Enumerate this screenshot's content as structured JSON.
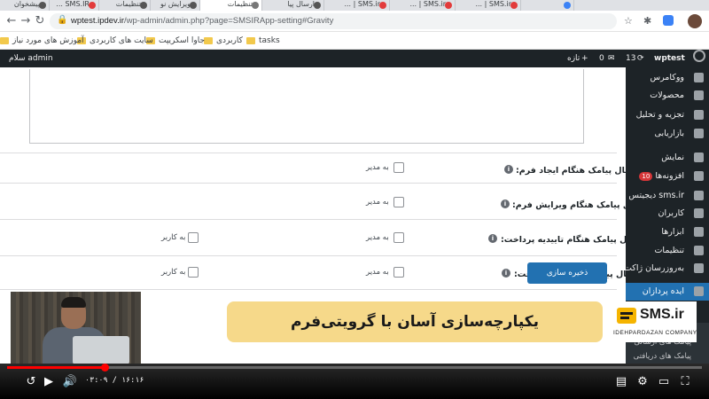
{
  "browser": {
    "tabs": [
      {
        "label": "پیشخوان",
        "icon": "wordpress-icon"
      },
      {
        "label": "SMS.IR ...",
        "icon": "sms-icon"
      },
      {
        "label": "تنظیمات",
        "icon": "wordpress-icon"
      },
      {
        "label": "ویرایش نو",
        "icon": "wordpress-icon"
      },
      {
        "label": "تنظیمات",
        "icon": "wordpress-icon",
        "active": true
      },
      {
        "label": "ارسال پیا",
        "icon": "wordpress-icon"
      },
      {
        "label": "SMS.ir | ...",
        "icon": "sms-icon"
      },
      {
        "label": "SMS.ir | ...",
        "icon": "sms-icon"
      },
      {
        "label": "SMS.ir | ...",
        "icon": "sms-icon"
      },
      {
        "label": "",
        "icon": "google-icon"
      }
    ],
    "url_domain": "wptest.ipdev.ir",
    "url_path": "/wp-admin/admin.php?page=SMSIRApp-setting#Gravity",
    "bookmarks": [
      "tasks",
      "کاربردی",
      "جاوا اسکریپت",
      "سایت های کاربردی",
      "آموزش های مورد نیاز"
    ]
  },
  "adminbar": {
    "site_name": "wptest",
    "updates_count": "13",
    "comments_count": "0",
    "new_label": "تازه",
    "greeting": "سلام admin"
  },
  "sidebar": {
    "items": [
      {
        "label": "ووکامرس",
        "icon": "woocommerce-icon"
      },
      {
        "label": "محصولات",
        "icon": "products-icon"
      },
      {
        "label": "تجزیه و تحلیل",
        "icon": "analytics-icon"
      },
      {
        "label": "بازاریابی",
        "icon": "marketing-icon"
      },
      {
        "label": "نمایش",
        "icon": "appearance-icon"
      },
      {
        "label": "افزونه‌ها",
        "icon": "plugins-icon",
        "badge": "10"
      },
      {
        "label": "sms.ir دیجیتس",
        "icon": "digits-icon"
      },
      {
        "label": "کاربران",
        "icon": "users-icon"
      },
      {
        "label": "ابزارها",
        "icon": "tools-icon"
      },
      {
        "label": "تنظیمات",
        "icon": "settings-icon"
      },
      {
        "label": "به‌روزرسان ژاکت",
        "icon": "update-icon"
      },
      {
        "label": "ایده پردازان",
        "icon": "smsir-icon",
        "active": true
      }
    ],
    "subitems": [
      "ارسال پیامک",
      "پیامک های ارسالی",
      "پیامک های دریافتی"
    ]
  },
  "form": {
    "rows": [
      {
        "label": "ارسال پیامک هنگام ایجاد فرم:",
        "admin": "به مدیر"
      },
      {
        "label": "ارسال پیامک هنگام ویرایش فرم:",
        "admin": "به مدیر"
      },
      {
        "label": "ارسال پیامک هنگام تاییدیه پرداخت:",
        "admin": "به مدیر",
        "user": "به کاربر"
      },
      {
        "label": "ارسال پیامک هنگام رد پرداخت:",
        "admin": "به مدیر",
        "user": "به کاربر"
      }
    ],
    "help_glyph": "i",
    "submit_label": "ذخیره سازی"
  },
  "overlay": {
    "banner_text": "یکپارچه‌سازی آسان با گرویتی‌فرم",
    "banner_color": "#f6d98a",
    "logo_text": "SMS.ir",
    "logo_sub": "IDEHPARDAZAN COMPANY"
  },
  "player": {
    "progress_fraction": 0.14,
    "timecode": "۰۳:۰۹ / ۱۶:۱۶",
    "accent": "#ff0000"
  }
}
